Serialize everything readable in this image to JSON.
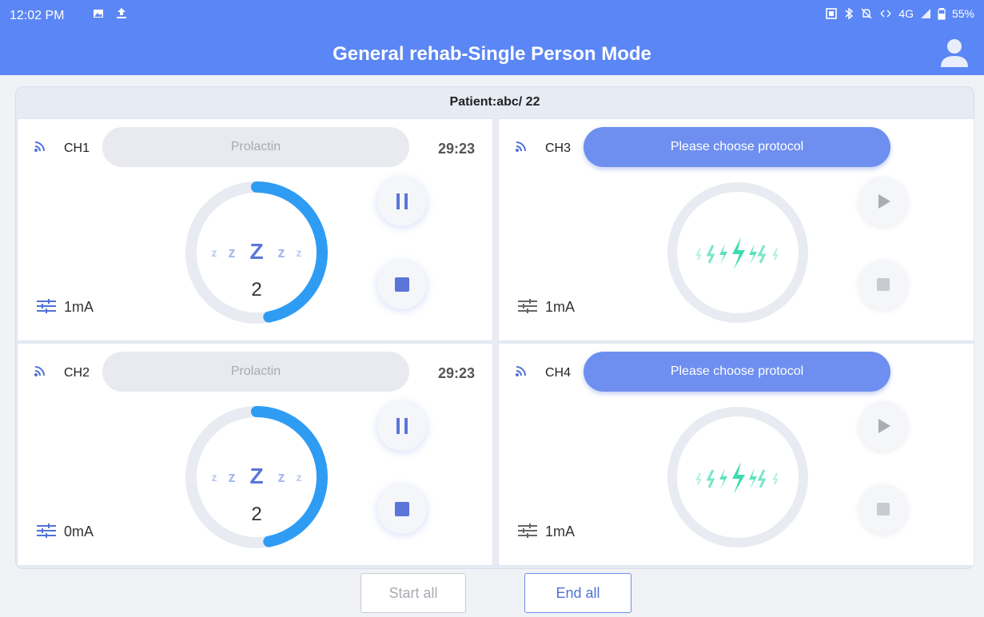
{
  "status_bar": {
    "time": "12:02 PM",
    "right_text": "4G",
    "battery": "55%",
    "icons": [
      "image-icon",
      "upload-icon",
      "screen-icon",
      "bluetooth-icon",
      "mute-icon",
      "data-icon",
      "signal-bars-icon",
      "battery-icon"
    ]
  },
  "app_bar": {
    "title": "General rehab-Single Person Mode",
    "icon": "avatar-icon"
  },
  "patient": "Patient:abc/ 22",
  "channels": [
    {
      "label": "CH1",
      "protocol": "Prolactin",
      "timer": "29:23",
      "center_value": "2",
      "intensity": "1mA",
      "state": "running",
      "progress": 0.47
    },
    {
      "label": "CH2",
      "protocol": "Prolactin",
      "timer": "29:23",
      "center_value": "2",
      "intensity": "0mA",
      "state": "running",
      "progress": 0.47
    },
    {
      "label": "CH3",
      "protocol": "Please choose protocol",
      "timer": "",
      "center_value": "",
      "intensity": "1mA",
      "state": "idle",
      "progress": 0
    },
    {
      "label": "CH4",
      "protocol": "Please choose protocol",
      "timer": "",
      "center_value": "",
      "intensity": "1mA",
      "state": "idle",
      "progress": 0
    }
  ],
  "buttons": {
    "start_all": "Start all",
    "end_all": "End all"
  },
  "colors": {
    "header": "#5b86f5",
    "ring_progress": "#2f9cf4",
    "active_protocol": "#6e8ff0",
    "idle_icon": "#3ddbb0"
  }
}
